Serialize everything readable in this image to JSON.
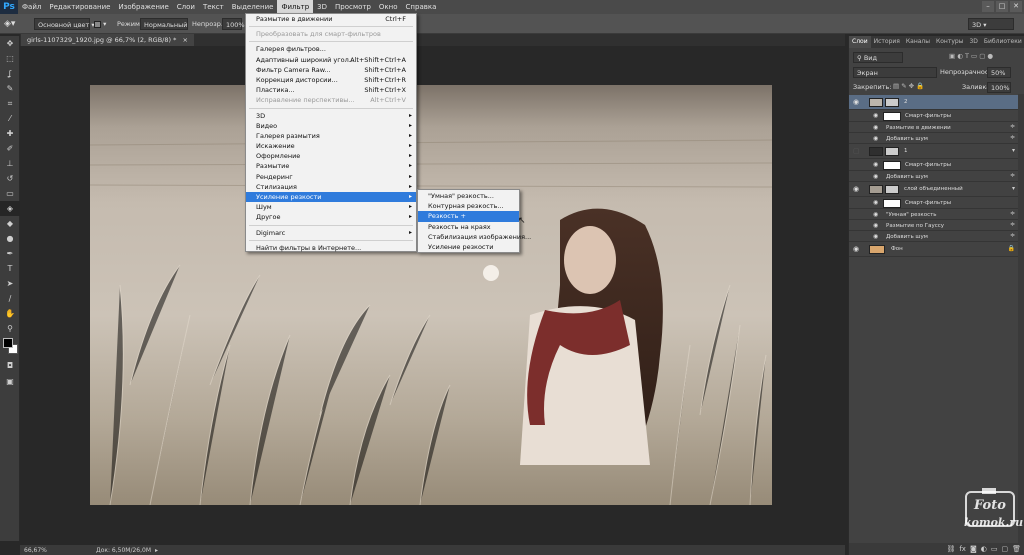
{
  "menubar": {
    "app_logo": "Ps",
    "items": [
      "Файл",
      "Редактирование",
      "Изображение",
      "Слои",
      "Текст",
      "Выделение",
      "Фильтр",
      "3D",
      "Просмотр",
      "Окно",
      "Справка"
    ],
    "active": "Фильтр",
    "window_buttons": [
      "–",
      "□",
      "✕"
    ]
  },
  "options_bar": {
    "tool_preset": "Основной цвет",
    "mode_label": "Режим:",
    "mode_value": "Нормальный",
    "opacity_label": "Непрозр.:",
    "opacity_value": "100%",
    "workspace": "3D"
  },
  "document": {
    "tab_title": "girls-1107329_1920.jpg @ 66,7% (2, RGB/8) *",
    "close_glyph": "×"
  },
  "status": {
    "zoom": "66,67%",
    "doc_size": "Док: 6,50M/26,0M"
  },
  "filter_menu": {
    "items": [
      {
        "label": "Размытие в движении",
        "shortcut": "Ctrl+F",
        "disabled": false
      },
      {
        "sep": true
      },
      {
        "label": "Преобразовать для смарт-фильтров",
        "disabled": true
      },
      {
        "sep": true
      },
      {
        "label": "Галерея фильтров...",
        "shortcut": ""
      },
      {
        "label": "Адаптивный широкий угол...",
        "shortcut": "Alt+Shift+Ctrl+A"
      },
      {
        "label": "Фильтр Camera Raw...",
        "shortcut": "Shift+Ctrl+A"
      },
      {
        "label": "Коррекция дисторсии...",
        "shortcut": "Shift+Ctrl+R"
      },
      {
        "label": "Пластика...",
        "shortcut": "Shift+Ctrl+X"
      },
      {
        "label": "Исправление перспективы...",
        "shortcut": "Alt+Ctrl+V",
        "disabled": true
      },
      {
        "sep": true
      },
      {
        "label": "3D",
        "sub": true
      },
      {
        "label": "Видео",
        "sub": true
      },
      {
        "label": "Галерея размытия",
        "sub": true
      },
      {
        "label": "Искажение",
        "sub": true
      },
      {
        "label": "Оформление",
        "sub": true
      },
      {
        "label": "Размытие",
        "sub": true
      },
      {
        "label": "Рендеринг",
        "sub": true
      },
      {
        "label": "Стилизация",
        "sub": true
      },
      {
        "label": "Усиление резкости",
        "sub": true,
        "highlight": true
      },
      {
        "label": "Шум",
        "sub": true
      },
      {
        "label": "Другое",
        "sub": true
      },
      {
        "sep": true
      },
      {
        "label": "Digimarc",
        "sub": true
      },
      {
        "sep": true
      },
      {
        "label": "Найти фильтры в Интернете...",
        "shortcut": ""
      }
    ]
  },
  "sharpen_submenu": {
    "items": [
      {
        "label": "\"Умная\" резкость..."
      },
      {
        "label": "Контурная резкость..."
      },
      {
        "label": "Резкость +",
        "highlight": true
      },
      {
        "label": "Резкость на краях"
      },
      {
        "label": "Стабилизация изображения..."
      },
      {
        "label": "Усиление резкости"
      }
    ]
  },
  "panel": {
    "tabs": [
      "Слои",
      "История",
      "Каналы",
      "Контуры",
      "3D",
      "Библиотеки"
    ],
    "active_tab": "Слои",
    "filter_kind": "Вид",
    "blend_mode": "Экран",
    "opacity_label": "Непрозрачность:",
    "opacity_value": "50%",
    "lock_label": "Закрепить:",
    "fill_label": "Заливка:",
    "fill_value": "100%",
    "layers": [
      {
        "name": "2",
        "type": "layer",
        "selected": true,
        "eye": true
      },
      {
        "name": "Смарт-фильтры",
        "type": "group"
      },
      {
        "name": "Размытие в движении",
        "type": "filter"
      },
      {
        "name": "Добавить шум",
        "type": "filter"
      },
      {
        "name": "1",
        "type": "layer",
        "eye": false
      },
      {
        "name": "Смарт-фильтры",
        "type": "group"
      },
      {
        "name": "Добавить шум",
        "type": "filter"
      },
      {
        "name": "слой объединенный",
        "type": "layer",
        "eye": true
      },
      {
        "name": "Смарт-фильтры",
        "type": "group"
      },
      {
        "name": "\"Умная\" резкость",
        "type": "filter"
      },
      {
        "name": "Размытие по Гауссу",
        "type": "filter"
      },
      {
        "name": "Добавить шум",
        "type": "filter"
      },
      {
        "name": "Фон",
        "type": "background",
        "eye": true
      }
    ],
    "bottom_icons": [
      "link-icon",
      "fx-icon",
      "mask-icon",
      "adjustment-icon",
      "folder-icon",
      "new-layer-icon",
      "trash-icon"
    ]
  },
  "watermark": {
    "line1": "Foto",
    "line2": "komok.ru"
  }
}
